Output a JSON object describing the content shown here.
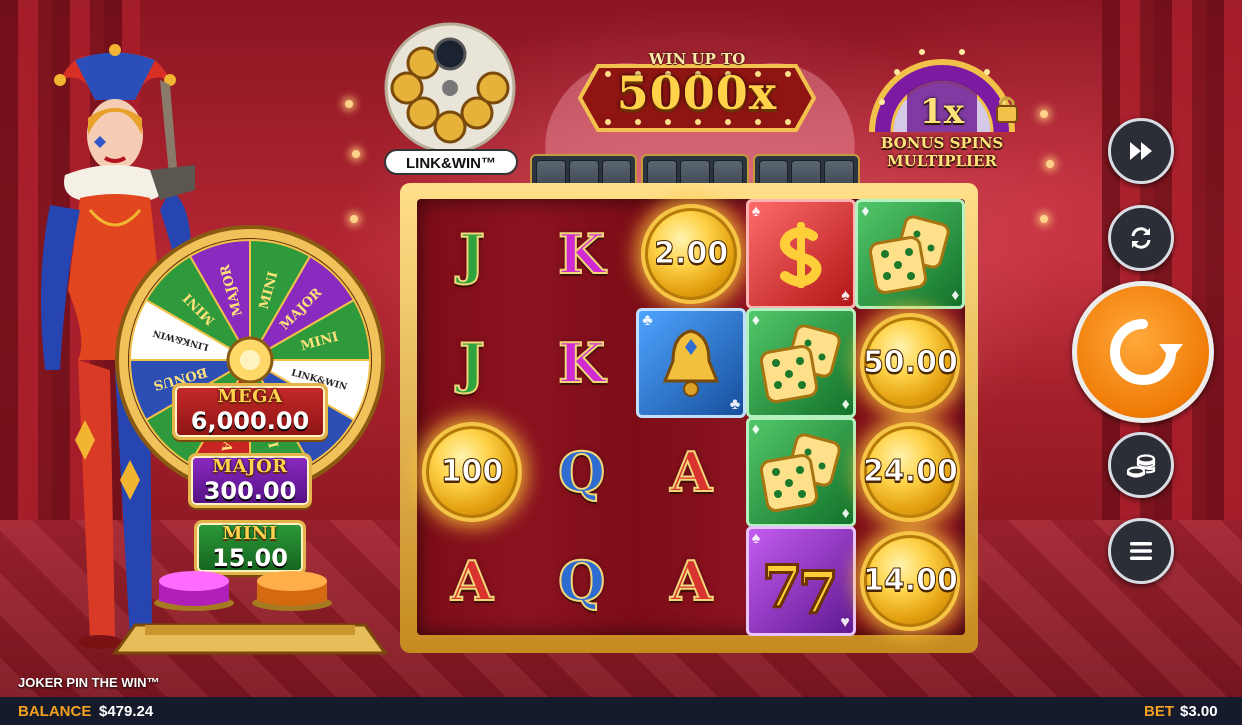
{
  "game": {
    "title": "JOKER PIN THE WIN™"
  },
  "header": {
    "link_win_logo": "LINK&WIN™",
    "win_up_to_label": "WIN UP TO",
    "win_up_to_value": "5000x",
    "multiplier_value": "1x",
    "multiplier_line1": "BONUS SPINS",
    "multiplier_line2": "MULTIPLIER"
  },
  "wheel": {
    "segments": [
      "MINI",
      "MAJOR",
      "MINI",
      "LINK&WIN",
      "BONUS SPINS",
      "MINI",
      "MEGA",
      "MINI",
      "BONUS",
      "LINK&WIN",
      "MINI",
      "MAJOR"
    ],
    "jackpots": [
      {
        "name": "MEGA",
        "value": "6,000.00",
        "color": "#b81f22"
      },
      {
        "name": "MAJOR",
        "value": "300.00",
        "color": "#6a1a9a"
      },
      {
        "name": "MINI",
        "value": "15.00",
        "color": "#1f7f2b"
      }
    ]
  },
  "reels": {
    "columns": 5,
    "rows": 4,
    "grid": [
      [
        {
          "kind": "letter",
          "value": "J"
        },
        {
          "kind": "letter",
          "value": "K"
        },
        {
          "kind": "coin",
          "value": "2.00"
        },
        {
          "kind": "tile",
          "symbol": "dollar",
          "color": "red"
        },
        {
          "kind": "tile",
          "symbol": "dice",
          "color": "green"
        }
      ],
      [
        {
          "kind": "letter",
          "value": "J"
        },
        {
          "kind": "letter",
          "value": "K"
        },
        {
          "kind": "tile",
          "symbol": "bell",
          "color": "blue"
        },
        {
          "kind": "tile",
          "symbol": "dice",
          "color": "green"
        },
        {
          "kind": "coin",
          "value": "50.00"
        }
      ],
      [
        {
          "kind": "coin",
          "value": "100"
        },
        {
          "kind": "letter",
          "value": "Q"
        },
        {
          "kind": "letter",
          "value": "A"
        },
        {
          "kind": "tile",
          "symbol": "dice",
          "color": "green"
        },
        {
          "kind": "coin",
          "value": "24.00"
        }
      ],
      [
        {
          "kind": "letter",
          "value": "A"
        },
        {
          "kind": "letter",
          "value": "Q"
        },
        {
          "kind": "letter",
          "value": "A"
        },
        {
          "kind": "tile",
          "symbol": "sevens",
          "color": "purple"
        },
        {
          "kind": "coin",
          "value": "14.00"
        }
      ]
    ]
  },
  "controls": {
    "turbo_icon": "fast-forward-icon",
    "autoplay_icon": "repeat-icon",
    "spin_icon": "spin-arrow-icon",
    "bet_icon": "coin-stack-icon",
    "menu_icon": "hamburger-menu-icon"
  },
  "footer": {
    "balance_label": "BALANCE",
    "balance_value": "$479.24",
    "bet_label": "BET",
    "bet_value": "$3.00"
  },
  "colors": {
    "accent": "#f3a020",
    "spin": "#f07b06",
    "background": "#a3202c"
  }
}
